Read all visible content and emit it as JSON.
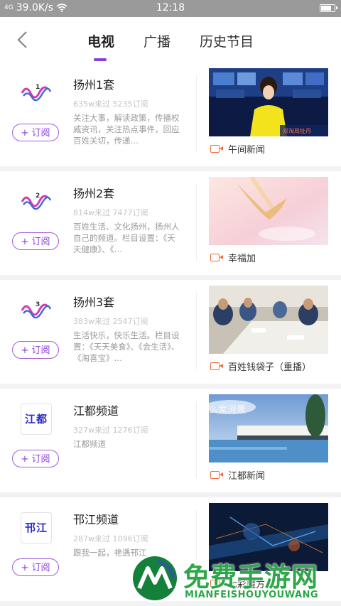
{
  "status_bar": {
    "signal": "4G",
    "speed": "39.0K/s",
    "time": "12:18",
    "battery_level": 0.85
  },
  "nav": {
    "tabs": [
      {
        "label": "电视",
        "active": true
      },
      {
        "label": "广播",
        "active": false
      },
      {
        "label": "历史节目",
        "active": false
      }
    ]
  },
  "channels": [
    {
      "name": "扬州1套",
      "visits": "635w来过",
      "subs": "5235订阅",
      "desc": "关注大事，解读政策，传播权威资讯，关注热点事件，回应百姓关切，传递…",
      "subscribe_label": "+ 订阅",
      "program": "午间新闻",
      "logo_num": "1"
    },
    {
      "name": "扬州2套",
      "visits": "814w来过",
      "subs": "7477订阅",
      "desc": "百姓生活、文化扬州，扬州人自己的频道。栏目设置：《天天健康》、《…",
      "subscribe_label": "+ 订阅",
      "program": "幸福加",
      "logo_num": "2"
    },
    {
      "name": "扬州3套",
      "visits": "383w来过",
      "subs": "2547订阅",
      "desc": "生活快乐，快乐生活。栏目设置：《天天美食》、《会生活》、《淘喜宝》…",
      "subscribe_label": "+ 订阅",
      "program": "百姓钱袋子（重播）",
      "logo_num": "3"
    },
    {
      "name": "江都频道",
      "visits": "327w来过",
      "subs": "1276订阅",
      "desc": "江都频道",
      "subscribe_label": "+ 订阅",
      "program": "江都新闻",
      "logo_text": "江都",
      "thumb_caption": "么家河景"
    },
    {
      "name": "邗江频道",
      "visits": "287w来过",
      "subs": "1096订阅",
      "desc": "跟我一起，艳遇邗江",
      "subscribe_label": "+ 订阅",
      "program": "七彩魔方",
      "logo_text": "邗江"
    }
  ],
  "thumb1_caption": "双淘局扯丹",
  "watermark": {
    "title": "免费手游网",
    "subtitle": "MIANFEISHOUYOUWANG"
  },
  "colors": {
    "accent": "#8b3fd9",
    "camera": "#f06a3a",
    "watermark": "#2ea64a"
  }
}
